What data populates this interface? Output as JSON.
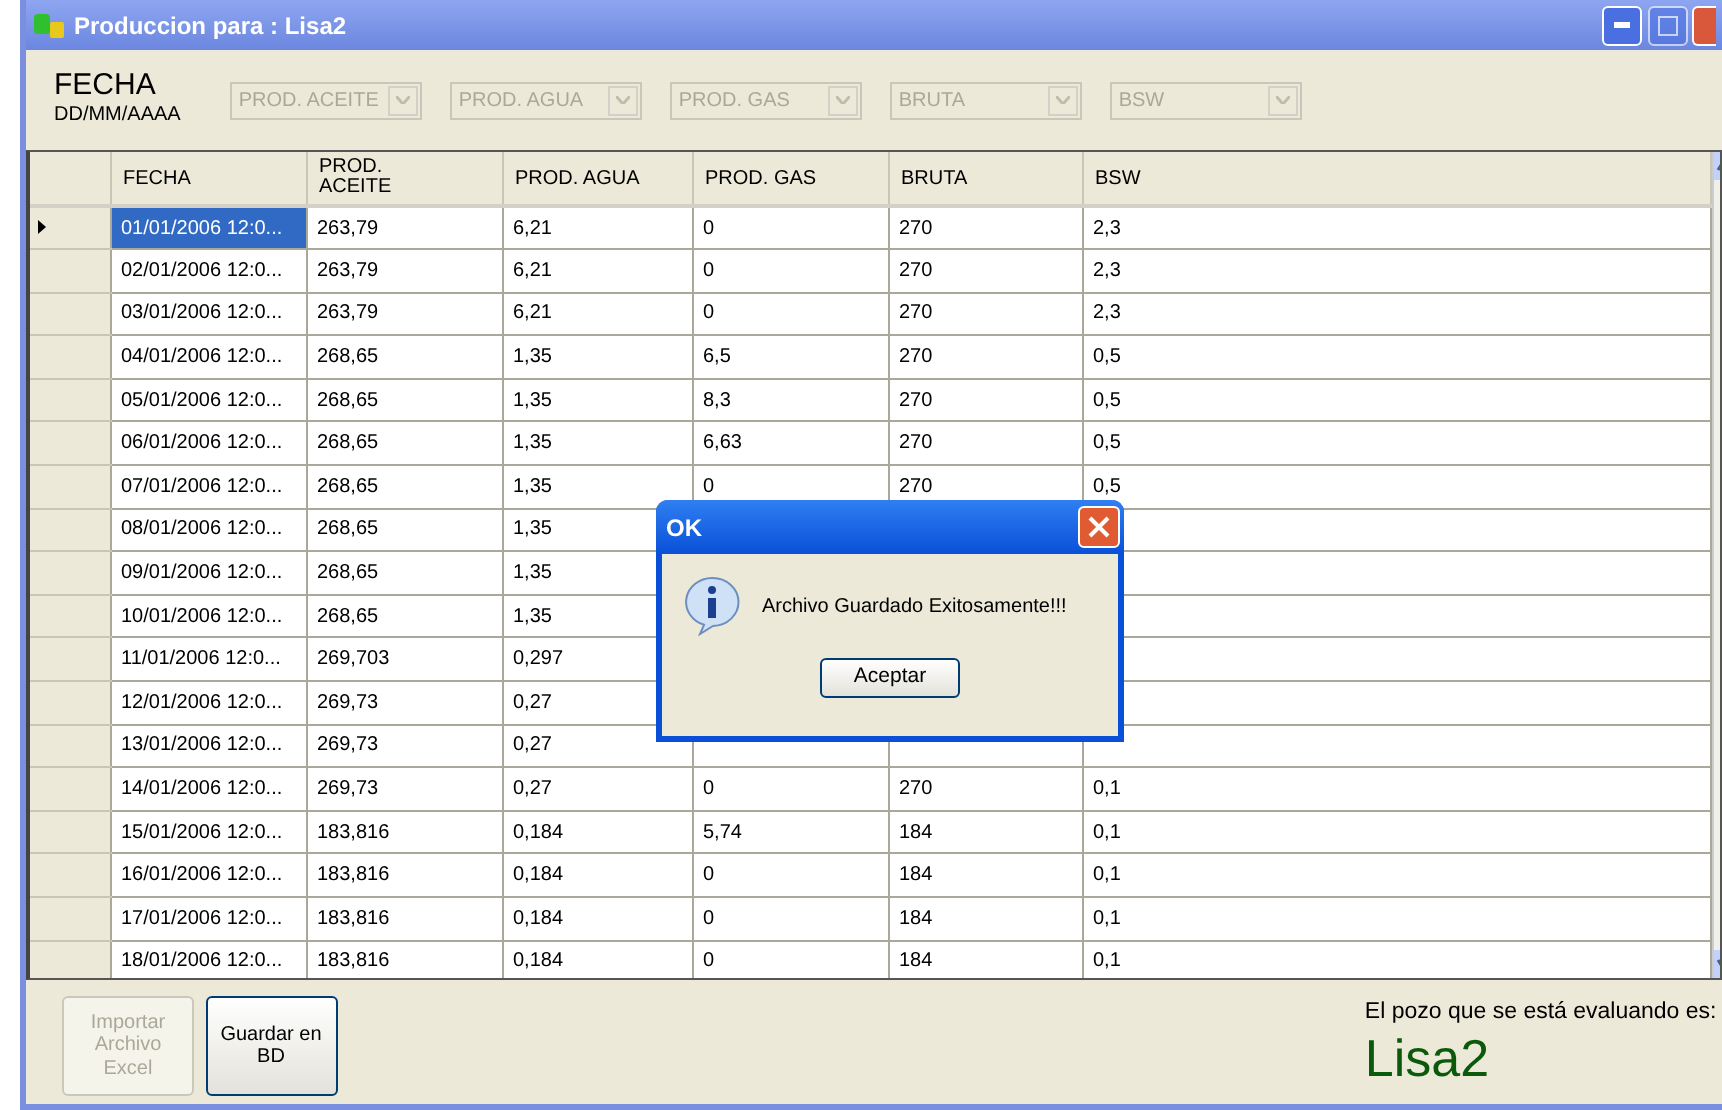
{
  "window": {
    "title": "Produccion para : Lisa2"
  },
  "date_label": {
    "title": "FECHA",
    "format": "DD/MM/AAAA"
  },
  "column_filters": [
    {
      "label": "PROD. ACEITE",
      "disabled": true
    },
    {
      "label": "PROD. AGUA",
      "disabled": true
    },
    {
      "label": "PROD. GAS",
      "disabled": true
    },
    {
      "label": "BRUTA",
      "disabled": true
    },
    {
      "label": "BSW",
      "disabled": true
    }
  ],
  "table": {
    "columns": [
      "FECHA",
      "PROD. ACEITE",
      "PROD. AGUA",
      "PROD. GAS",
      "BRUTA",
      "BSW"
    ],
    "rows": [
      {
        "selected": true,
        "cells": [
          "01/01/2006 12:0...",
          "263,79",
          "6,21",
          "0",
          "270",
          "2,3"
        ]
      },
      {
        "selected": false,
        "cells": [
          "02/01/2006 12:0...",
          "263,79",
          "6,21",
          "0",
          "270",
          "2,3"
        ]
      },
      {
        "selected": false,
        "cells": [
          "03/01/2006 12:0...",
          "263,79",
          "6,21",
          "0",
          "270",
          "2,3"
        ]
      },
      {
        "selected": false,
        "cells": [
          "04/01/2006 12:0...",
          "268,65",
          "1,35",
          "6,5",
          "270",
          "0,5"
        ]
      },
      {
        "selected": false,
        "cells": [
          "05/01/2006 12:0...",
          "268,65",
          "1,35",
          "8,3",
          "270",
          "0,5"
        ]
      },
      {
        "selected": false,
        "cells": [
          "06/01/2006 12:0...",
          "268,65",
          "1,35",
          "6,63",
          "270",
          "0,5"
        ]
      },
      {
        "selected": false,
        "cells": [
          "07/01/2006 12:0...",
          "268,65",
          "1,35",
          "0",
          "270",
          "0,5"
        ]
      },
      {
        "selected": false,
        "cells": [
          "08/01/2006 12:0...",
          "268,65",
          "1,35",
          null,
          null,
          null
        ]
      },
      {
        "selected": false,
        "cells": [
          "09/01/2006 12:0...",
          "268,65",
          "1,35",
          null,
          null,
          null
        ]
      },
      {
        "selected": false,
        "cells": [
          "10/01/2006 12:0...",
          "268,65",
          "1,35",
          null,
          null,
          null
        ]
      },
      {
        "selected": false,
        "cells": [
          "11/01/2006 12:0...",
          "269,703",
          "0,297",
          null,
          null,
          null
        ]
      },
      {
        "selected": false,
        "cells": [
          "12/01/2006 12:0...",
          "269,73",
          "0,27",
          null,
          null,
          null
        ]
      },
      {
        "selected": false,
        "cells": [
          "13/01/2006 12:0...",
          "269,73",
          "0,27",
          null,
          null,
          null
        ]
      },
      {
        "selected": false,
        "cells": [
          "14/01/2006 12:0...",
          "269,73",
          "0,27",
          "0",
          "270",
          "0,1"
        ]
      },
      {
        "selected": false,
        "cells": [
          "15/01/2006 12:0...",
          "183,816",
          "0,184",
          "5,74",
          "184",
          "0,1"
        ]
      },
      {
        "selected": false,
        "cells": [
          "16/01/2006 12:0...",
          "183,816",
          "0,184",
          "0",
          "184",
          "0,1"
        ]
      },
      {
        "selected": false,
        "cells": [
          "17/01/2006 12:0...",
          "183,816",
          "0,184",
          "0",
          "184",
          "0,1"
        ]
      },
      {
        "selected": false,
        "cells": [
          "18/01/2006 12:0...",
          "183,816",
          "0,184",
          "0",
          "184",
          "0,1"
        ]
      }
    ]
  },
  "buttons": [
    {
      "label": "Importar Archivo Excel",
      "disabled": true
    },
    {
      "label": "Guardar en BD",
      "disabled": false
    }
  ],
  "status": {
    "caption": "El pozo que se está evaluando es:",
    "well": "Lisa2"
  },
  "dialog": {
    "title": "OK",
    "message": "Archivo Guardado Exitosamente!!!",
    "button": "Aceptar"
  }
}
